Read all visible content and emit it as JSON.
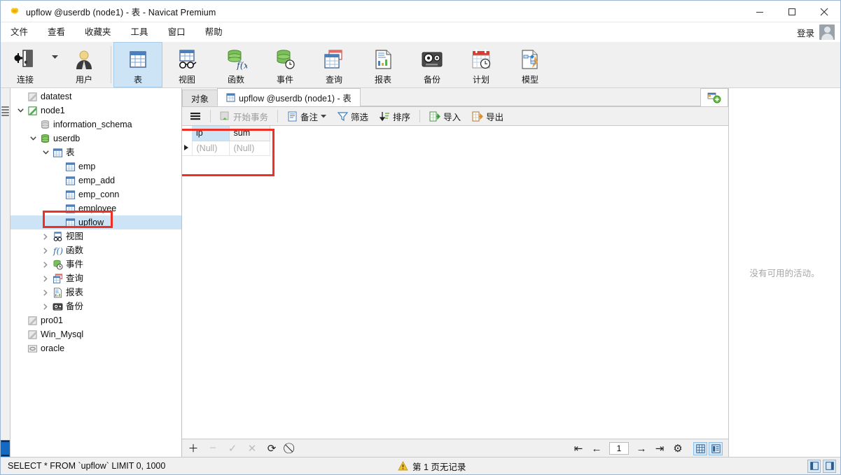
{
  "window": {
    "title": "upflow @userdb (node1) - 表 - Navicat Premium",
    "app_icon": "navicat-logo-icon",
    "minimize": "–",
    "maximize": "□",
    "close": "✕"
  },
  "menubar": {
    "items": [
      {
        "label": "文件",
        "name": "menu-file"
      },
      {
        "label": "查看",
        "name": "menu-view"
      },
      {
        "label": "收藏夹",
        "name": "menu-favorites"
      },
      {
        "label": "工具",
        "name": "menu-tools"
      },
      {
        "label": "窗口",
        "name": "menu-window"
      },
      {
        "label": "帮助",
        "name": "menu-help"
      }
    ],
    "login_label": "登录"
  },
  "toolbar": {
    "items": [
      {
        "label": "连接",
        "name": "toolbar-connection",
        "icon": "connection-plug-icon",
        "active": false
      },
      {
        "label": "用户",
        "name": "toolbar-user",
        "icon": "user-icon",
        "active": false
      },
      {
        "label": "表",
        "name": "toolbar-table",
        "icon": "table-icon",
        "active": true
      },
      {
        "label": "视图",
        "name": "toolbar-view",
        "icon": "view-glasses-icon",
        "active": false
      },
      {
        "label": "函数",
        "name": "toolbar-function",
        "icon": "function-fx-icon",
        "active": false
      },
      {
        "label": "事件",
        "name": "toolbar-event",
        "icon": "event-clock-icon",
        "active": false
      },
      {
        "label": "查询",
        "name": "toolbar-query",
        "icon": "query-icon",
        "active": false
      },
      {
        "label": "报表",
        "name": "toolbar-report",
        "icon": "report-icon",
        "active": false
      },
      {
        "label": "备份",
        "name": "toolbar-backup",
        "icon": "backup-tape-icon",
        "active": false
      },
      {
        "label": "计划",
        "name": "toolbar-schedule",
        "icon": "schedule-calendar-icon",
        "active": false
      },
      {
        "label": "模型",
        "name": "toolbar-model",
        "icon": "model-diagram-icon",
        "active": false
      }
    ]
  },
  "sidebar": {
    "items": [
      {
        "label": "datatest",
        "depth": 0,
        "icon": "connection-icon",
        "twisty": "",
        "selected": false
      },
      {
        "label": "node1",
        "depth": 0,
        "icon": "connection-open-icon",
        "twisty": "v",
        "selected": false
      },
      {
        "label": "information_schema",
        "depth": 1,
        "icon": "database-gray-icon",
        "twisty": "",
        "selected": false
      },
      {
        "label": "userdb",
        "depth": 1,
        "icon": "database-icon",
        "twisty": "v",
        "selected": false
      },
      {
        "label": "表",
        "depth": 2,
        "icon": "table-folder-icon",
        "twisty": "v",
        "selected": false
      },
      {
        "label": "emp",
        "depth": 3,
        "icon": "table-icon",
        "twisty": "",
        "selected": false
      },
      {
        "label": "emp_add",
        "depth": 3,
        "icon": "table-icon",
        "twisty": "",
        "selected": false
      },
      {
        "label": "emp_conn",
        "depth": 3,
        "icon": "table-icon",
        "twisty": "",
        "selected": false
      },
      {
        "label": "employee",
        "depth": 3,
        "icon": "table-icon",
        "twisty": "",
        "selected": false
      },
      {
        "label": "upflow",
        "depth": 3,
        "icon": "table-icon",
        "twisty": "",
        "selected": true
      },
      {
        "label": "视图",
        "depth": 2,
        "icon": "view-glasses-icon",
        "twisty": ">",
        "selected": false
      },
      {
        "label": "函数",
        "depth": 2,
        "icon": "function-fx-icon",
        "twisty": ">",
        "selected": false
      },
      {
        "label": "事件",
        "depth": 2,
        "icon": "event-clock-icon",
        "twisty": ">",
        "selected": false
      },
      {
        "label": "查询",
        "depth": 2,
        "icon": "query-icon",
        "twisty": ">",
        "selected": false
      },
      {
        "label": "报表",
        "depth": 2,
        "icon": "report-icon",
        "twisty": ">",
        "selected": false
      },
      {
        "label": "备份",
        "depth": 2,
        "icon": "backup-tape-icon",
        "twisty": ">",
        "selected": false
      },
      {
        "label": "pro01",
        "depth": 0,
        "icon": "connection-icon",
        "twisty": "",
        "selected": false
      },
      {
        "label": "Win_Mysql",
        "depth": 0,
        "icon": "connection-icon",
        "twisty": "",
        "selected": false
      },
      {
        "label": "oracle",
        "depth": 0,
        "icon": "oracle-icon",
        "twisty": "",
        "selected": false
      }
    ]
  },
  "tabs": {
    "items": [
      {
        "label": "对象",
        "name": "tab-objects",
        "icon": "",
        "active": false
      },
      {
        "label": "upflow @userdb (node1) - 表",
        "name": "tab-upflow-table",
        "icon": "table-icon",
        "active": true
      }
    ],
    "new_tab_icon": "new-query-plus-icon"
  },
  "data_toolbar": {
    "items": [
      {
        "label": "",
        "name": "grid-menu-button",
        "icon": "hamburger-icon",
        "dim": false
      },
      {
        "label": "开始事务",
        "name": "begin-transaction-button",
        "icon": "transaction-icon",
        "dim": true
      },
      {
        "label": "备注",
        "name": "note-button",
        "icon": "note-icon",
        "dim": false,
        "caret": true
      },
      {
        "label": "筛选",
        "name": "filter-button",
        "icon": "filter-icon",
        "dim": false
      },
      {
        "label": "排序",
        "name": "sort-button",
        "icon": "sort-icon",
        "dim": false
      },
      {
        "label": "导入",
        "name": "import-button",
        "icon": "import-icon",
        "dim": false
      },
      {
        "label": "导出",
        "name": "export-button",
        "icon": "export-icon",
        "dim": false
      }
    ]
  },
  "grid": {
    "columns": [
      {
        "label": "ip",
        "selected": true
      },
      {
        "label": "sum",
        "selected": false
      }
    ],
    "rows": [
      {
        "cells": [
          "(Null)",
          "(Null)"
        ],
        "current": true
      }
    ]
  },
  "grid_footer": {
    "buttons": [
      {
        "name": "add-record-button",
        "glyph": "＋",
        "dim": false
      },
      {
        "name": "delete-record-button",
        "glyph": "−",
        "dim": true
      },
      {
        "name": "apply-change-button",
        "glyph": "✓",
        "dim": true
      },
      {
        "name": "cancel-change-button",
        "glyph": "✕",
        "dim": true
      },
      {
        "name": "refresh-button",
        "glyph": "⟳",
        "dim": false
      },
      {
        "name": "stop-button",
        "glyph": "⃠",
        "dim": false
      }
    ],
    "nav": {
      "first": "⇤",
      "prev": "←",
      "page": "1",
      "next": "→",
      "last": "⇥",
      "settings": "⚙"
    },
    "view_modes": [
      {
        "name": "grid-view-button",
        "icon": "grid-view-icon",
        "active": true
      },
      {
        "name": "form-view-button",
        "icon": "form-view-icon",
        "active": true
      }
    ]
  },
  "right_panel": {
    "empty_text": "没有可用的活动。"
  },
  "statusbar": {
    "sql": "SELECT * FROM `upflow` LIMIT 0, 1000",
    "warning_icon": "warning-icon",
    "rows_text": "第 1 页无记录",
    "buttons": [
      {
        "name": "toggle-left-panel-button",
        "icon": "left-panel-icon"
      },
      {
        "name": "toggle-right-panel-button",
        "icon": "right-panel-icon"
      }
    ]
  },
  "colors": {
    "accent": "#cde4f7",
    "highlight_box": "#ee3124",
    "toolbar_bg": "#f0f0f0"
  }
}
